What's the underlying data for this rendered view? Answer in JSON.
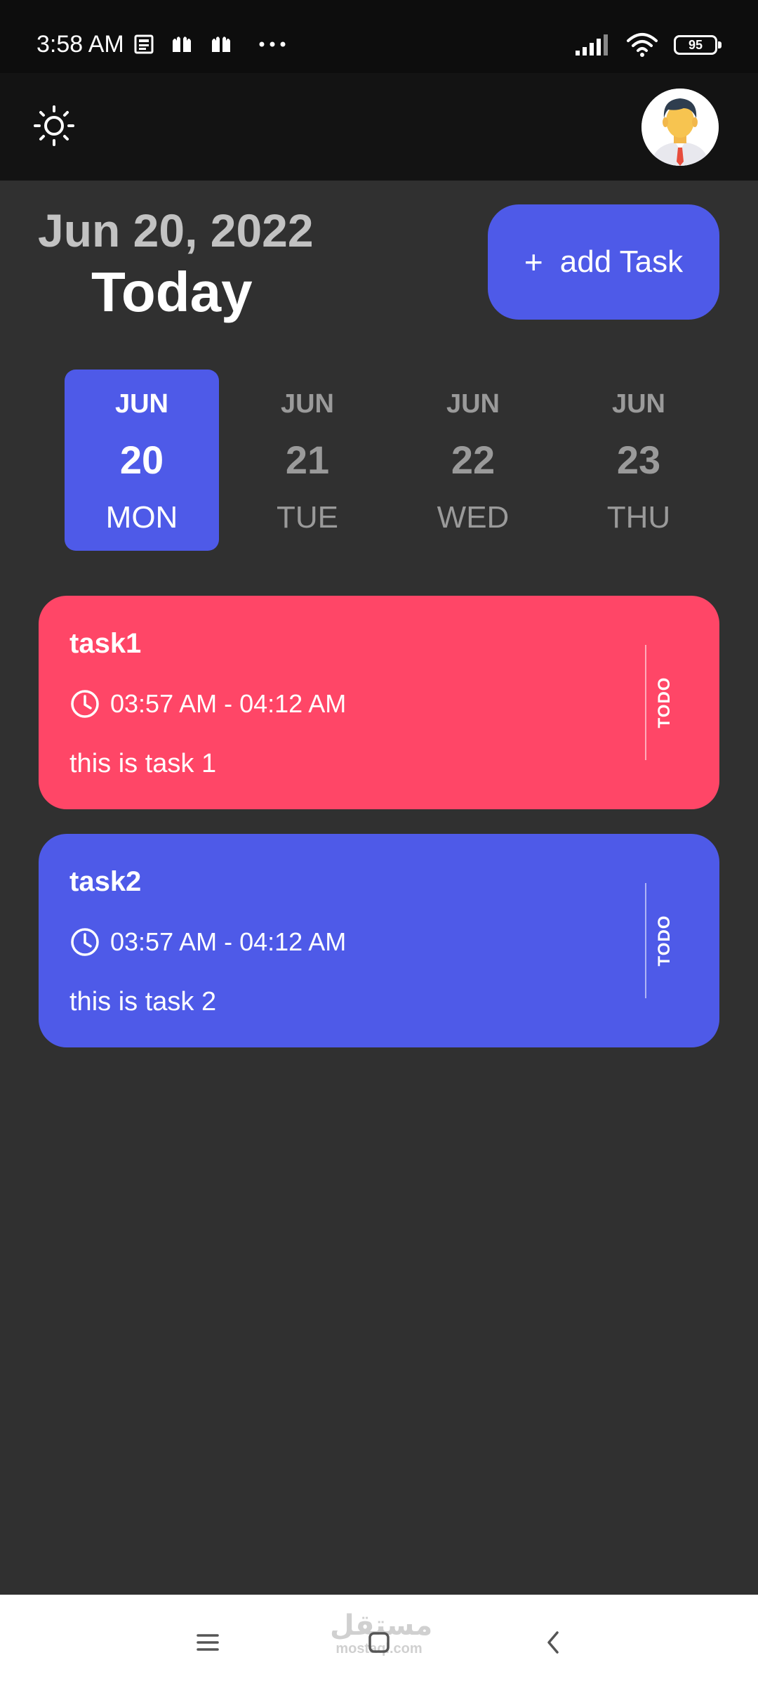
{
  "status_bar": {
    "time": "3:58 AM",
    "battery": "95",
    "notification_icons": [
      "news-icon",
      "hands-icon",
      "hands-icon",
      "more-dots-icon"
    ],
    "right_icons": [
      "signal-icon",
      "wifi-icon",
      "battery-icon"
    ]
  },
  "app_bar": {
    "theme_icon": "sun-icon",
    "avatar_icon": "user-avatar"
  },
  "header": {
    "date": "Jun 20, 2022",
    "today": "Today",
    "add_task_icon": "+",
    "add_task_label": "add Task"
  },
  "date_picker": {
    "selected_color": "#4e5ae8",
    "days": [
      {
        "month": "JUN",
        "day": "20",
        "weekday": "MON",
        "selected": true
      },
      {
        "month": "JUN",
        "day": "21",
        "weekday": "TUE",
        "selected": false
      },
      {
        "month": "JUN",
        "day": "22",
        "weekday": "WED",
        "selected": false
      },
      {
        "month": "JUN",
        "day": "23",
        "weekday": "THU",
        "selected": false
      }
    ]
  },
  "tasks": [
    {
      "title": "task1",
      "time": "03:57 AM - 04:12 AM",
      "description": "this is task 1",
      "status": "TODO",
      "color": "#ff4667"
    },
    {
      "title": "task2",
      "time": "03:57 AM - 04:12 AM",
      "description": "this is task 2",
      "status": "TODO",
      "color": "#4e5ae8"
    }
  ],
  "nav_bar": {
    "watermark_arabic": "مستقل",
    "watermark_latin": "mostaql.com",
    "buttons": [
      "menu-icon",
      "home-icon",
      "back-icon"
    ]
  }
}
